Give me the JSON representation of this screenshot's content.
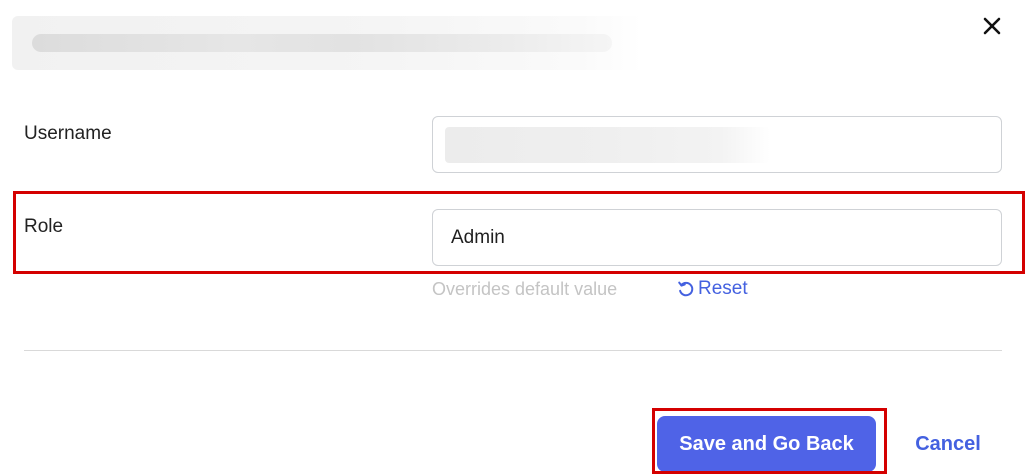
{
  "dialog": {
    "close_icon": "close-icon"
  },
  "form": {
    "username": {
      "label": "Username",
      "value": ""
    },
    "role": {
      "label": "Role",
      "value": "Admin",
      "hint": "Overrides default value",
      "reset_label": "Reset",
      "reset_icon": "reset-icon"
    }
  },
  "footer": {
    "save_label": "Save and Go Back",
    "cancel_label": "Cancel"
  },
  "colors": {
    "primary": "#4f63e7",
    "link": "#4461e0",
    "highlight": "#d40000"
  }
}
